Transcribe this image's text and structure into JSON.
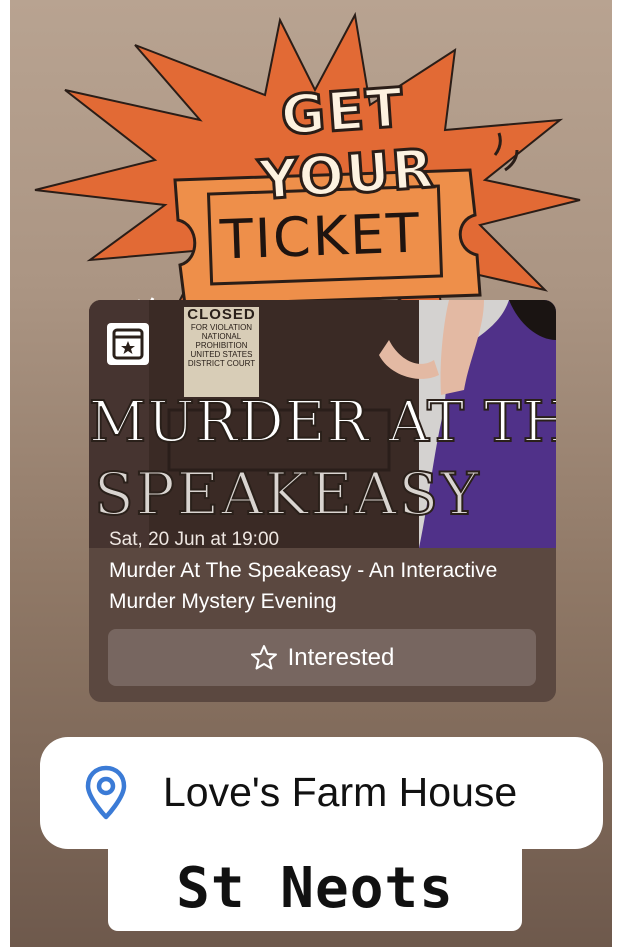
{
  "sticker": {
    "headline": "GET YOUR",
    "ticket_word": "TICKET",
    "colors": {
      "burst": "#e26a35",
      "ticket": "#ee8f4a",
      "outline": "#2a1d17",
      "headline_fill": "#fdf2e0"
    }
  },
  "event": {
    "icon": "calendar-star-icon",
    "poster": {
      "sign_lines": [
        "CLOSED",
        "FOR VIOLATION",
        "NATIONAL",
        "PROHIBITION",
        "UNITED STATES",
        "DISTRICT COURT"
      ],
      "title_line_1": "MURDER AT THE",
      "title_line_2": "SPEAKEASY"
    },
    "date": "Sat, 20 Jun at 19:00",
    "title": "Murder At The Speakeasy - An Interactive Murder Mystery Evening",
    "interested_label": "Interested",
    "interested_icon": "star-outline-icon"
  },
  "location": {
    "icon": "location-pin-icon",
    "name": "Love's Farm House",
    "pin_color": "#3b7bd6"
  },
  "town": {
    "name": "St Neots"
  }
}
